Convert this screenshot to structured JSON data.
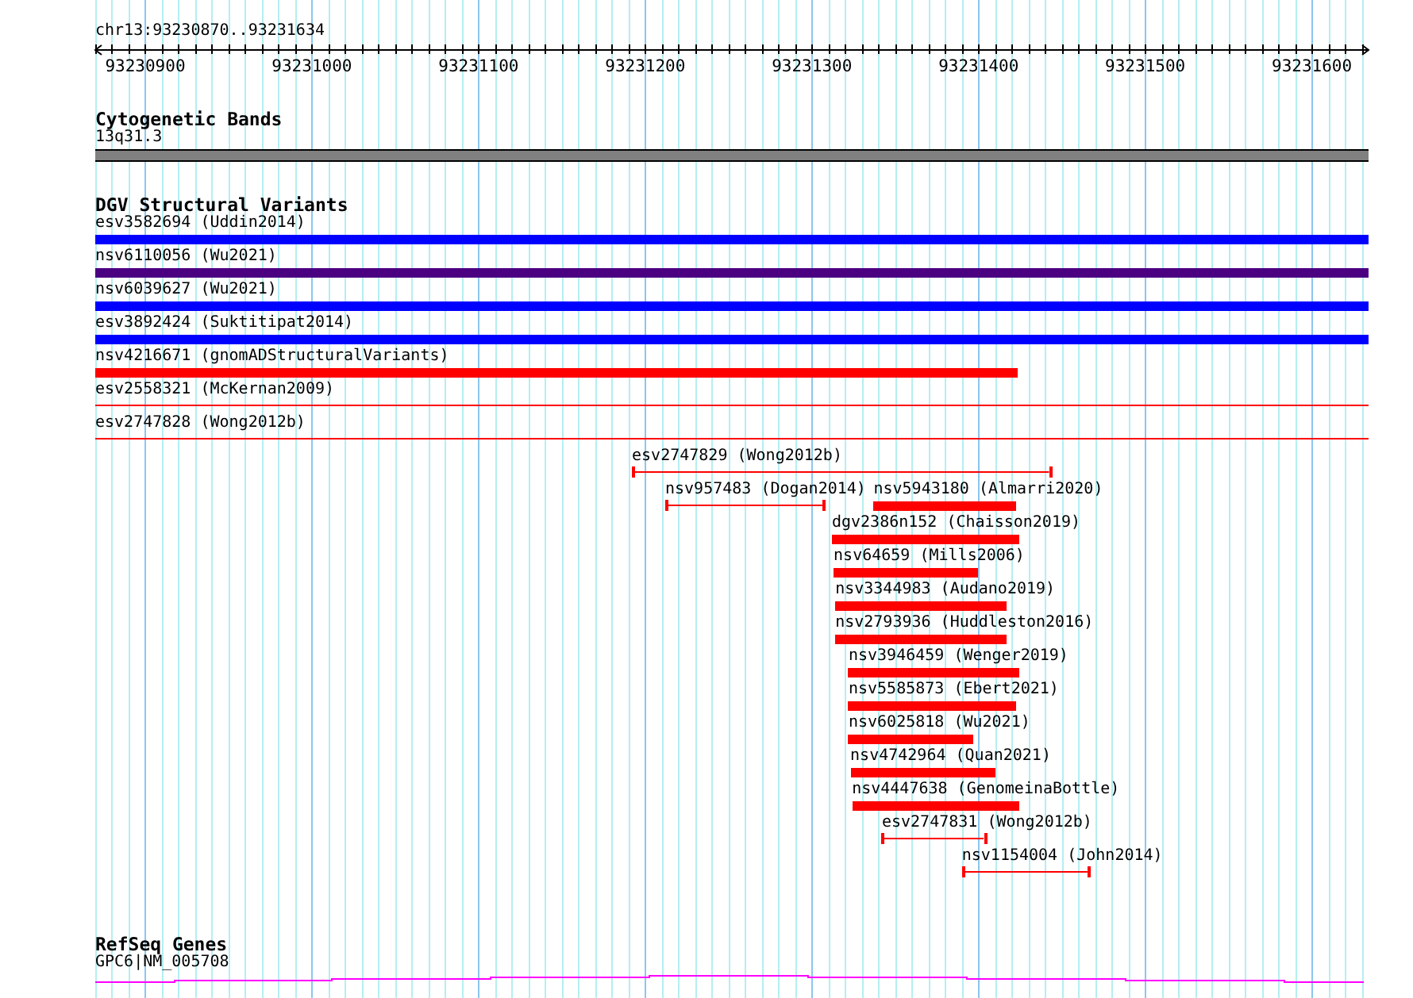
{
  "location": "chr13:93230870..93231634",
  "ruler": {
    "ticks": [
      "93230900",
      "93231000",
      "93231100",
      "93231200",
      "93231300",
      "93231400",
      "93231500",
      "93231600"
    ]
  },
  "tracks": [
    {
      "kind": "bands",
      "title": "Cytogenetic Bands",
      "label": "13q31.3"
    },
    {
      "kind": "features",
      "title": "DGV Structural Variants",
      "rows": [
        {
          "features": [
            {
              "name": "esv3582694 (Uddin2014)",
              "kind": "bar",
              "color": "#0000ff"
            }
          ]
        },
        {
          "features": [
            {
              "name": "nsv6110056 (Wu2021)",
              "kind": "bar",
              "color": "#4b0082"
            }
          ]
        },
        {
          "features": [
            {
              "name": "nsv6039627 (Wu2021)",
              "kind": "bar",
              "color": "#0000ff"
            }
          ]
        },
        {
          "features": [
            {
              "name": "esv3892424 (Suktitipat2014)",
              "kind": "bar",
              "color": "#0000ff"
            }
          ]
        },
        {
          "features": [
            {
              "name": "nsv4216671 (gnomADStructuralVariants)",
              "kind": "bar",
              "color": "#ff0000"
            }
          ]
        },
        {
          "features": [
            {
              "name": "esv2558321 (McKernan2009)",
              "kind": "line",
              "color": "#ff0000"
            }
          ]
        },
        {
          "features": [
            {
              "name": "esv2747828 (Wong2012b)",
              "kind": "line",
              "color": "#ff0000"
            }
          ]
        },
        {
          "features": [
            {
              "name": "esv2747829 (Wong2012b)",
              "kind": "interval",
              "color": "#ff0000"
            }
          ]
        },
        {
          "features": [
            {
              "name": "nsv957483 (Dogan2014)",
              "kind": "interval",
              "color": "#ff0000"
            },
            {
              "name": "nsv5943180 (Almarri2020)",
              "kind": "bar",
              "color": "#ff0000"
            }
          ]
        },
        {
          "features": [
            {
              "name": "dgv2386n152 (Chaisson2019)",
              "kind": "bar",
              "color": "#ff0000"
            }
          ]
        },
        {
          "features": [
            {
              "name": "nsv64659 (Mills2006)",
              "kind": "bar",
              "color": "#ff0000"
            }
          ]
        },
        {
          "features": [
            {
              "name": "nsv3344983 (Audano2019)",
              "kind": "bar",
              "color": "#ff0000"
            }
          ]
        },
        {
          "features": [
            {
              "name": "nsv2793936 (Huddleston2016)",
              "kind": "bar",
              "color": "#ff0000"
            }
          ]
        },
        {
          "features": [
            {
              "name": "nsv3946459 (Wenger2019)",
              "kind": "bar",
              "color": "#ff0000"
            }
          ]
        },
        {
          "features": [
            {
              "name": "nsv5585873 (Ebert2021)",
              "kind": "bar",
              "color": "#ff0000"
            }
          ]
        },
        {
          "features": [
            {
              "name": "nsv6025818 (Wu2021)",
              "kind": "bar",
              "color": "#ff0000"
            }
          ]
        },
        {
          "features": [
            {
              "name": "nsv4742964 (Quan2021)",
              "kind": "bar",
              "color": "#ff0000"
            }
          ]
        },
        {
          "features": [
            {
              "name": "nsv4447638 (GenomeinaBottle)",
              "kind": "bar",
              "color": "#ff0000"
            }
          ]
        },
        {
          "features": [
            {
              "name": "esv2747831 (Wong2012b)",
              "kind": "interval",
              "color": "#ff0000"
            }
          ]
        },
        {
          "features": [
            {
              "name": "nsv1154004 (John2014)",
              "kind": "interval",
              "color": "#ff0000"
            }
          ]
        }
      ]
    },
    {
      "kind": "gene",
      "title": "RefSeq Genes",
      "label": "GPC6|NM_005708"
    }
  ]
}
